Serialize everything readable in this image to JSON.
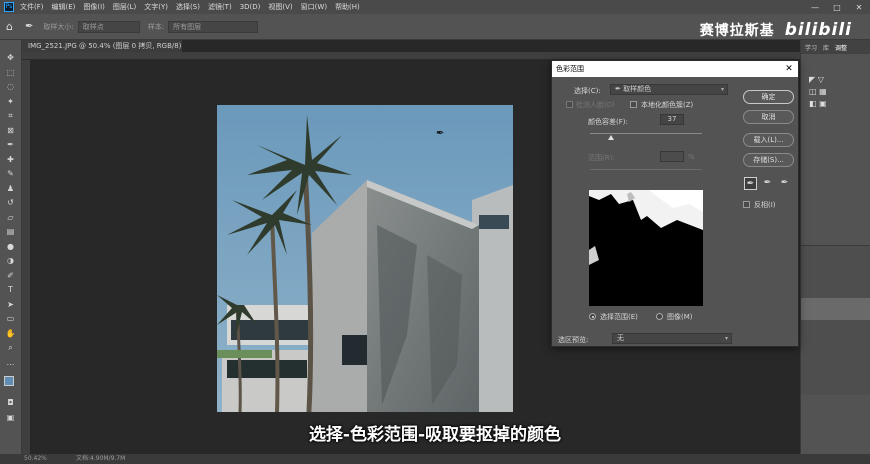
{
  "app": {
    "logo": "Ps"
  },
  "menu": [
    "文件(F)",
    "编辑(E)",
    "图像(I)",
    "图层(L)",
    "文字(Y)",
    "选择(S)",
    "滤镜(T)",
    "3D(D)",
    "视图(V)",
    "窗口(W)",
    "帮助(H)"
  ],
  "window_controls": [
    "—",
    "□",
    "✕"
  ],
  "options_bar": {
    "sample_size_label": "取样大小:",
    "sample_size_value": "取样点",
    "sample_label": "样本:",
    "sample_value": "所有图层"
  },
  "watermark": {
    "author": "赛博拉斯基",
    "brand": "bilibili"
  },
  "document": {
    "tab_title": "IMG_2521.JPG @ 50.4% (图层 0 拷贝, RGB/8) *"
  },
  "status": {
    "zoom": "50.42%",
    "doc_info": "文档:4.90M/9.7M"
  },
  "right_panel": {
    "tabs": [
      "学习",
      "库",
      "调整"
    ]
  },
  "subtitle": "选择-色彩范围-吸取要抠掉的颜色",
  "dialog": {
    "title": "色彩范围",
    "select_label": "选择(C):",
    "select_value": "取样颜色",
    "detect_faces_label": "检测人脸(D)",
    "localized_label": "本地化颜色簇(Z)",
    "fuzziness_label": "颜色容差(F):",
    "fuzziness_value": "37",
    "range_label": "范围(R):",
    "range_unit": "%",
    "selection_radio": "选择范围(E)",
    "image_radio": "图像(M)",
    "preview_label": "选区预览:",
    "preview_value": "无",
    "buttons": {
      "ok": "确定",
      "cancel": "取消",
      "load": "载入(L)...",
      "save": "存储(S)..."
    },
    "invert_label": "反相(I)"
  }
}
